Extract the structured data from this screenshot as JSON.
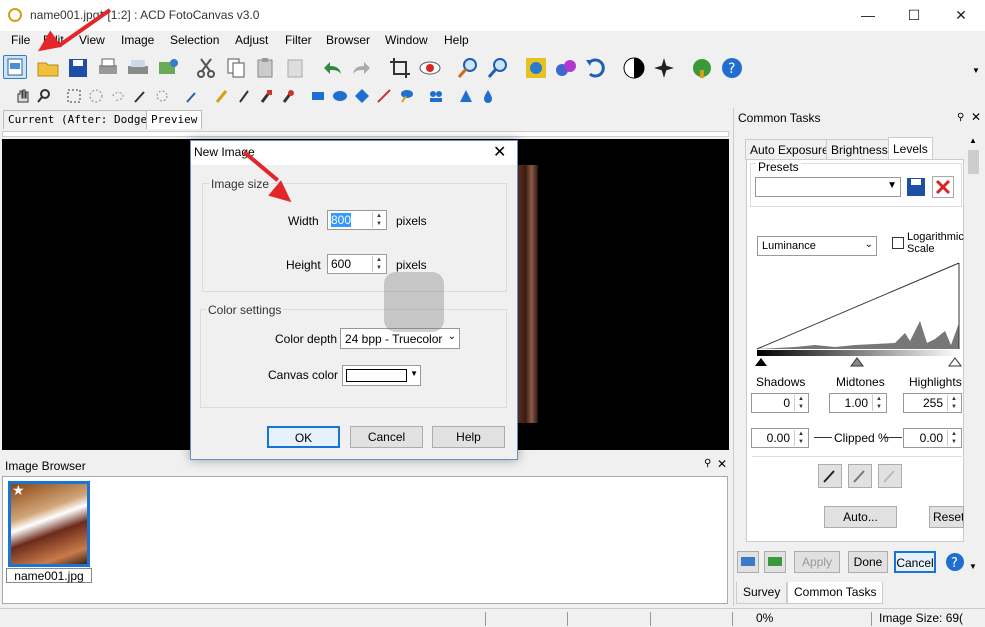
{
  "window": {
    "title": "name001.jpg* [1:2] : ACD FotoCanvas v3.0",
    "minimize": "—",
    "maximize": "☐",
    "close": "✕"
  },
  "menu": [
    "File",
    "Edit",
    "View",
    "Image",
    "Selection",
    "Adjust",
    "Filter",
    "Browser",
    "Window",
    "Help"
  ],
  "view_tabs": [
    "Current (After: Dodge)",
    "Preview"
  ],
  "dialog": {
    "title": "New Image",
    "close": "✕",
    "image_size_label": "Image size",
    "width_label": "Width",
    "width_value": "800",
    "height_label": "Height",
    "height_value": "600",
    "units": "pixels",
    "color_settings_label": "Color settings",
    "color_depth_label": "Color depth",
    "color_depth_value": "24 bpp - Truecolor",
    "canvas_color_label": "Canvas color",
    "ok": "OK",
    "cancel": "Cancel",
    "help": "Help"
  },
  "image_browser": {
    "title": "Image Browser",
    "thumb_label": "name001.jpg"
  },
  "panel": {
    "title": "Common Tasks",
    "tabs": [
      "Auto Exposure",
      "Brightness",
      "Levels"
    ],
    "presets_label": "Presets",
    "channel": "Luminance",
    "log_label": "Logarithmic Scale",
    "shadows_label": "Shadows",
    "midtones_label": "Midtones",
    "highlights_label": "Highlights",
    "shadows": "0",
    "midtones": "1.00",
    "highlights": "255",
    "clipped_low": "0.00",
    "clipped_label": "Clipped %",
    "clipped_high": "0.00",
    "auto": "Auto...",
    "reset": "Reset",
    "apply": "Apply",
    "done": "Done",
    "cancel": "Cancel",
    "bottom_tabs": [
      "Survey",
      "Common Tasks"
    ]
  },
  "status": {
    "zoom": "0%",
    "image_size": "Image Size: 69("
  },
  "colors": {
    "accent": "#1a74d4",
    "arrow": "#e4262a",
    "highlight_btn": "#cce4f7"
  }
}
